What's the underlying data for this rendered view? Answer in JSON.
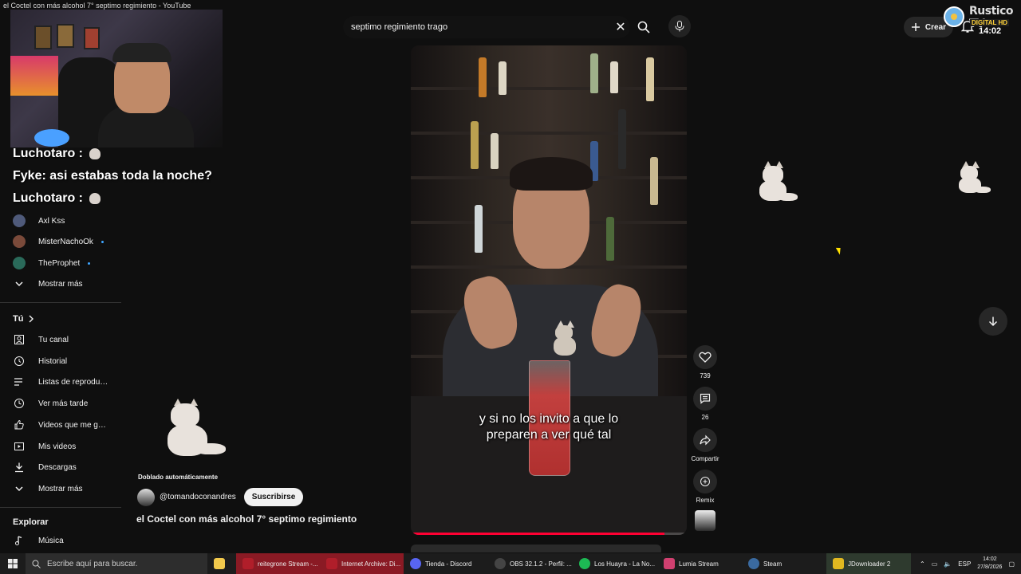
{
  "window": {
    "title": "el Coctel con más alcohol 7° septimo regimiento - YouTube"
  },
  "chat_overlay": [
    {
      "user": "Luchotaro",
      "message": ":"
    },
    {
      "user": "Fyke",
      "message": ": asi estabas toda la noche?"
    },
    {
      "user": "Luchotaro",
      "message": ":"
    }
  ],
  "sidebar": {
    "subscriptions": [
      {
        "label": "Axl Kss",
        "avatar_color": "#4f5a7a",
        "live": false
      },
      {
        "label": "MisterNachoOk",
        "avatar_color": "#7a4a3a",
        "live": true
      },
      {
        "label": "TheProphet",
        "avatar_color": "#2a6a5a",
        "live": true
      }
    ],
    "show_more_1": "Mostrar más",
    "you_heading": "Tú",
    "you_items": [
      {
        "label": "Tu canal",
        "icon": "channel-icon"
      },
      {
        "label": "Historial",
        "icon": "history-icon"
      },
      {
        "label": "Listas de reproducción",
        "icon": "playlists-icon"
      },
      {
        "label": "Ver más tarde",
        "icon": "clock-icon"
      },
      {
        "label": "Videos que me gustan",
        "icon": "thumbs-up-icon"
      },
      {
        "label": "Mis videos",
        "icon": "video-icon"
      },
      {
        "label": "Descargas",
        "icon": "download-icon"
      }
    ],
    "show_more_2": "Mostrar más",
    "explore_heading": "Explorar",
    "explore_items": [
      {
        "label": "Música",
        "icon": "music-icon"
      }
    ]
  },
  "search": {
    "value": "septimo regimiento trago",
    "placeholder": "Buscar"
  },
  "header": {
    "create_label": "Crear"
  },
  "tv_logo": {
    "name": "Rustico TV",
    "digital": "DIGITAL HD",
    "clock": "14:02"
  },
  "video": {
    "caption_line1": "y si no los invito a que lo",
    "caption_line2": "preparen a ver qué tal",
    "progress": 0.92
  },
  "actions": {
    "likes": "739",
    "comments": "26",
    "share": "Compartir",
    "remix": "Remix"
  },
  "channel": {
    "dubbed": "Doblado automáticamente",
    "handle": "@tomandoconandres",
    "subscribe": "Suscribirse",
    "title": "el Coctel con más alcohol 7° septimo regimiento"
  },
  "taskbar": {
    "search_placeholder": "Escribe aquí para buscar.",
    "apps": [
      {
        "label": "",
        "color": "#f2c94c",
        "active": false
      },
      {
        "label": "reitegrone Stream -...",
        "color": "#b01e2a",
        "active": true
      },
      {
        "label": "Internet Archive: Di...",
        "color": "#b01e2a",
        "active": true
      },
      {
        "label": "Tienda - Discord",
        "color": "#5865f2",
        "active": false
      },
      {
        "label": "OBS 32.1.2 - Perfil: ...",
        "color": "#444444",
        "active": false
      },
      {
        "label": "Los Huayra - La No...",
        "color": "#1db954",
        "active": false
      },
      {
        "label": "Lumia Stream",
        "color": "#d04070",
        "active": false
      },
      {
        "label": "Steam",
        "color": "#3a6aa0",
        "active": false
      },
      {
        "label": "JDownloader 2",
        "color": "#e0b820",
        "active": true
      }
    ],
    "language": "ESP",
    "time": "14:02",
    "date": "27/8/2026"
  }
}
